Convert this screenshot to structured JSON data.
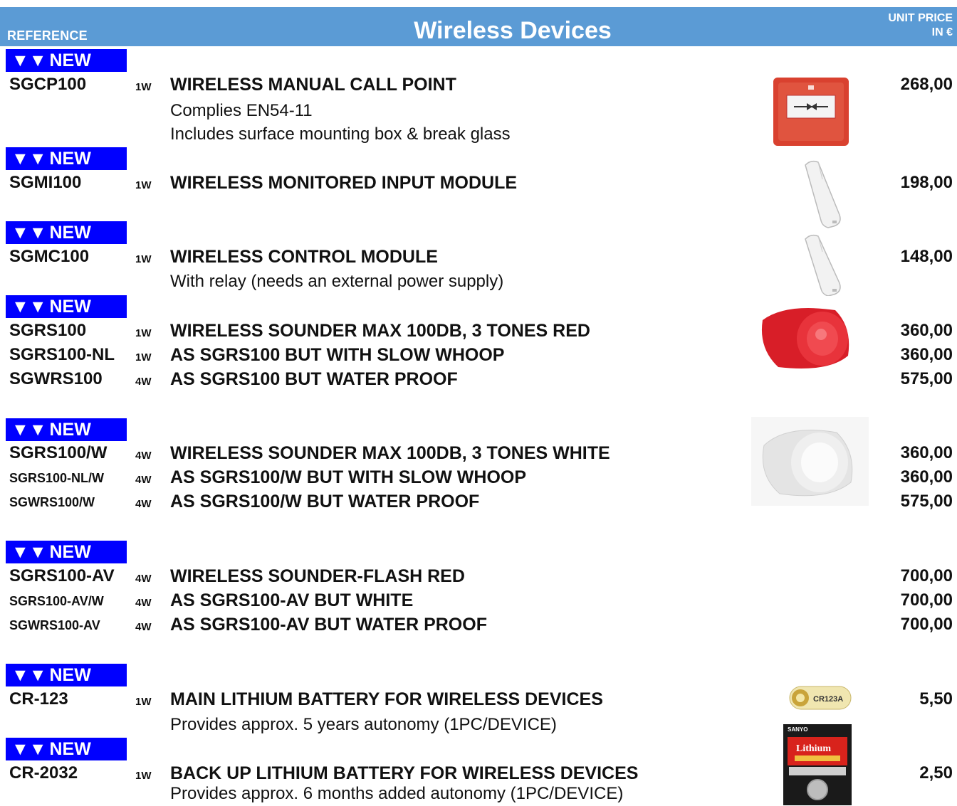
{
  "header": {
    "reference_label": "REFERENCE",
    "title": "Wireless Devices",
    "price_label_line1": "UNIT PRICE",
    "price_label_line2": "IN €"
  },
  "badge": {
    "arrows": "▼▼",
    "text": "NEW"
  },
  "products": [
    {
      "ref": "SGCP100",
      "qty": "1W",
      "desc": "WIRELESS  MANUAL CALL POINT",
      "price": "268,00",
      "notes": [
        "Complies EN54-11",
        "Includes surface mounting box & break glass"
      ],
      "image_icon": "call-point-image"
    },
    {
      "ref": "SGMI100",
      "qty": "1W",
      "desc": "WIRELESS MONITORED INPUT MODULE",
      "price": "198,00",
      "image_icon": "input-module-image"
    },
    {
      "ref": "SGMC100",
      "qty": "1W",
      "desc": "WIRELESS CONTROL MODULE",
      "price": "148,00",
      "notes": [
        "With relay (needs an external power supply)"
      ],
      "image_icon": "control-module-image"
    },
    {
      "ref": "SGRS100",
      "qty": "1W",
      "desc": "WIRELESS  SOUNDER MAX 100DB, 3 TONES RED",
      "price": "360,00",
      "image_icon": "red-sounder-image"
    },
    {
      "ref": "SGRS100-NL",
      "qty": "1W",
      "desc": "AS SGRS100 BUT WITH SLOW WHOOP",
      "price": "360,00"
    },
    {
      "ref": "SGWRS100",
      "qty": "4W",
      "desc": "AS SGRS100 BUT WATER PROOF",
      "price": "575,00"
    },
    {
      "ref": "SGRS100/W",
      "qty": "4W",
      "desc": "WIRELESS  SOUNDER MAX 100DB, 3 TONES WHITE",
      "price": "360,00",
      "image_icon": "white-sounder-image"
    },
    {
      "ref": "SGRS100-NL/W",
      "qty": "4W",
      "desc": "AS SGRS100/W BUT WITH SLOW WHOOP",
      "price": "360,00"
    },
    {
      "ref": "SGWRS100/W",
      "qty": "4W",
      "desc": "AS SGRS100/W BUT WATER PROOF",
      "price": "575,00"
    },
    {
      "ref": "SGRS100-AV",
      "qty": "4W",
      "desc": "WIRELESS  SOUNDER-FLASH RED",
      "price": "700,00"
    },
    {
      "ref": "SGRS100-AV/W",
      "qty": "4W",
      "desc": "AS SGRS100-AV BUT WHITE",
      "price": "700,00"
    },
    {
      "ref": "SGWRS100-AV",
      "qty": "4W",
      "desc": "AS SGRS100-AV BUT WATER PROOF",
      "price": "700,00"
    },
    {
      "ref": "CR-123",
      "qty": "1W",
      "desc": "MAIN LITHIUM BATTERY FOR WIRELESS DEVICES",
      "price": "5,50",
      "notes": [
        "Provides approx. 5 years autonomy (1PC/DEVICE)"
      ],
      "image_icon": "cr123-battery-image",
      "image_label": "CR123A"
    },
    {
      "ref": "CR-2032",
      "qty": "1W",
      "desc": "BACK UP LITHIUM BATTERY FOR WIRELESS DEVICES",
      "price": "2,50",
      "notes": [
        "Provides approx. 6 months added autonomy (1PC/DEVICE)"
      ],
      "image_icon": "cr2032-battery-image",
      "image_brand": "SANYO",
      "image_label": "Lithium"
    }
  ]
}
